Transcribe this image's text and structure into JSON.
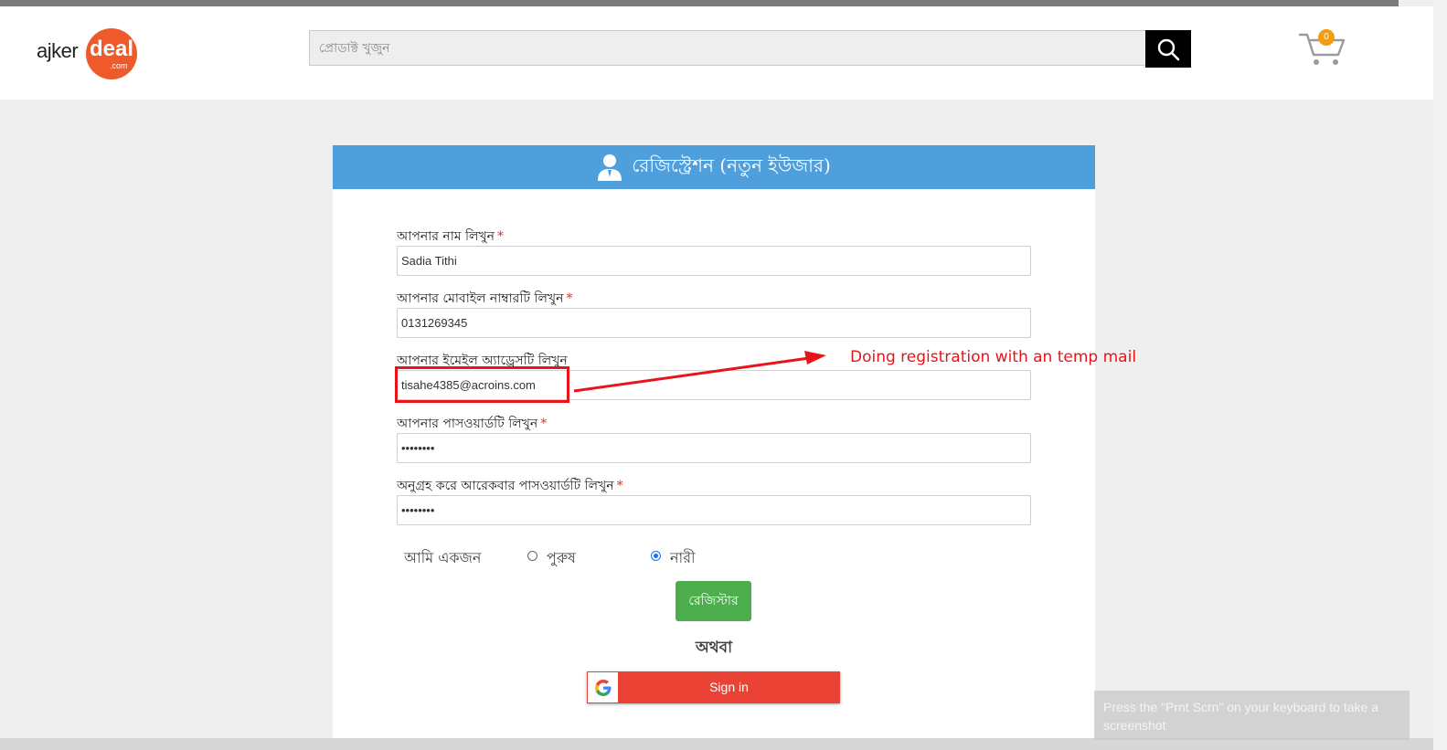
{
  "header": {
    "logo": {
      "ajker": "ajker",
      "deal": "deal",
      "com": ".com"
    },
    "search_placeholder": "প্রোডাক্ট খুজুন",
    "cart_count": "0"
  },
  "form": {
    "title": "রেজিস্ট্রেশন (নতুন ইউজার)",
    "name_label": "আপনার নাম লিখুন",
    "name_value": "Sadia Tithi",
    "mobile_label": "আপনার মোবাইল নাম্বারটি লিখুন",
    "mobile_value": "0131269345",
    "email_label": "আপনার ইমেইল অ্যাড্রেসটি লিখুন",
    "email_value": "tisahe4385@acroins.com",
    "password_label": "আপনার পাসওয়ার্ডটি লিখুন",
    "password_value": "••••••••",
    "confirm_label": "অনুগ্রহ করে আরেকবার পাসওয়ার্ডটি লিখুন",
    "confirm_value": "••••••••",
    "required_mark": "*",
    "gender_label": "আমি একজন",
    "gender_options": [
      {
        "label": "পুরুষ",
        "checked": false
      },
      {
        "label": "নারী",
        "checked": true
      }
    ],
    "register_button": "রেজিস্টার",
    "or_text": "অথবা",
    "google_signin": "Sign in"
  },
  "annotation": {
    "text": "Doing registration with an temp mail",
    "color": "#e8141b"
  },
  "toast": {
    "text": "Press the \"Prnt Scrn\" on your keyboard to take a screenshot"
  },
  "colors": {
    "header_blue": "#4f9fdc",
    "register_green": "#4cae4c",
    "google_red": "#ea4335",
    "logo_orange": "#ef5a2a"
  }
}
